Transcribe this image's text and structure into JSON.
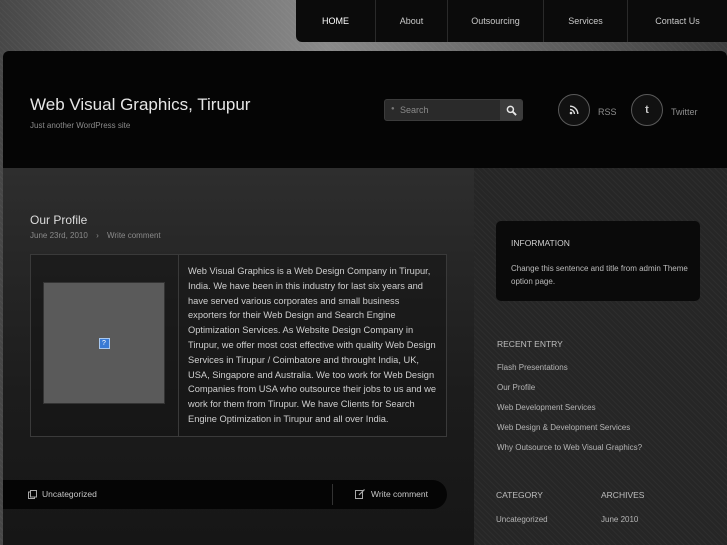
{
  "nav": {
    "items": [
      {
        "label": "HOME"
      },
      {
        "label": "About"
      },
      {
        "label": "Outsourcing"
      },
      {
        "label": "Services"
      },
      {
        "label": "Contact Us"
      }
    ]
  },
  "header": {
    "site_title": "Web Visual Graphics, Tirupur",
    "tagline": "Just another WordPress site",
    "search_placeholder": "Search",
    "rss_label": "RSS",
    "twitter_label": "Twitter"
  },
  "post": {
    "title": "Our Profile",
    "date": "June 23rd, 2010",
    "meta_separator": "›",
    "comment_link": "Write comment",
    "body": "Web Visual Graphics is a Web Design Company in Tirupur, India. We have been in this industry for last six years and have served various corporates and small business exporters for their Web Design and Search Engine Optimization Services. As Website Design  Company in Tirupur, we offer most cost effective with quality Web Design Services in Tirupur / Coimbatore and throught India, UK, USA, Singapore and Australia. We too work for Web Design Companies from USA who outsource their jobs to us and we work for them from Tirupur. We have Clients for Search Engine Optimization in Tirupur and all over India.",
    "category": "Uncategorized",
    "footer_comment": "Write comment"
  },
  "sidebar": {
    "info_title": "INFORMATION",
    "info_text": "Change this sentence and title from admin Theme option page.",
    "recent_title": "RECENT ENTRY",
    "recent_entries": [
      "Flash Presentations",
      "Our Profile",
      "Web Development Services",
      "Web Design & Development Services",
      "Why Outsource to Web Visual Graphics?"
    ],
    "category_title": "CATEGORY",
    "category_item": "Uncategorized",
    "archives_title": "ARCHIVES",
    "archives_item": "June 2010"
  },
  "colors": {
    "header_bg": "#050505",
    "text_light": "#cfcfcf",
    "accent_blue": "#3a7bd5"
  }
}
